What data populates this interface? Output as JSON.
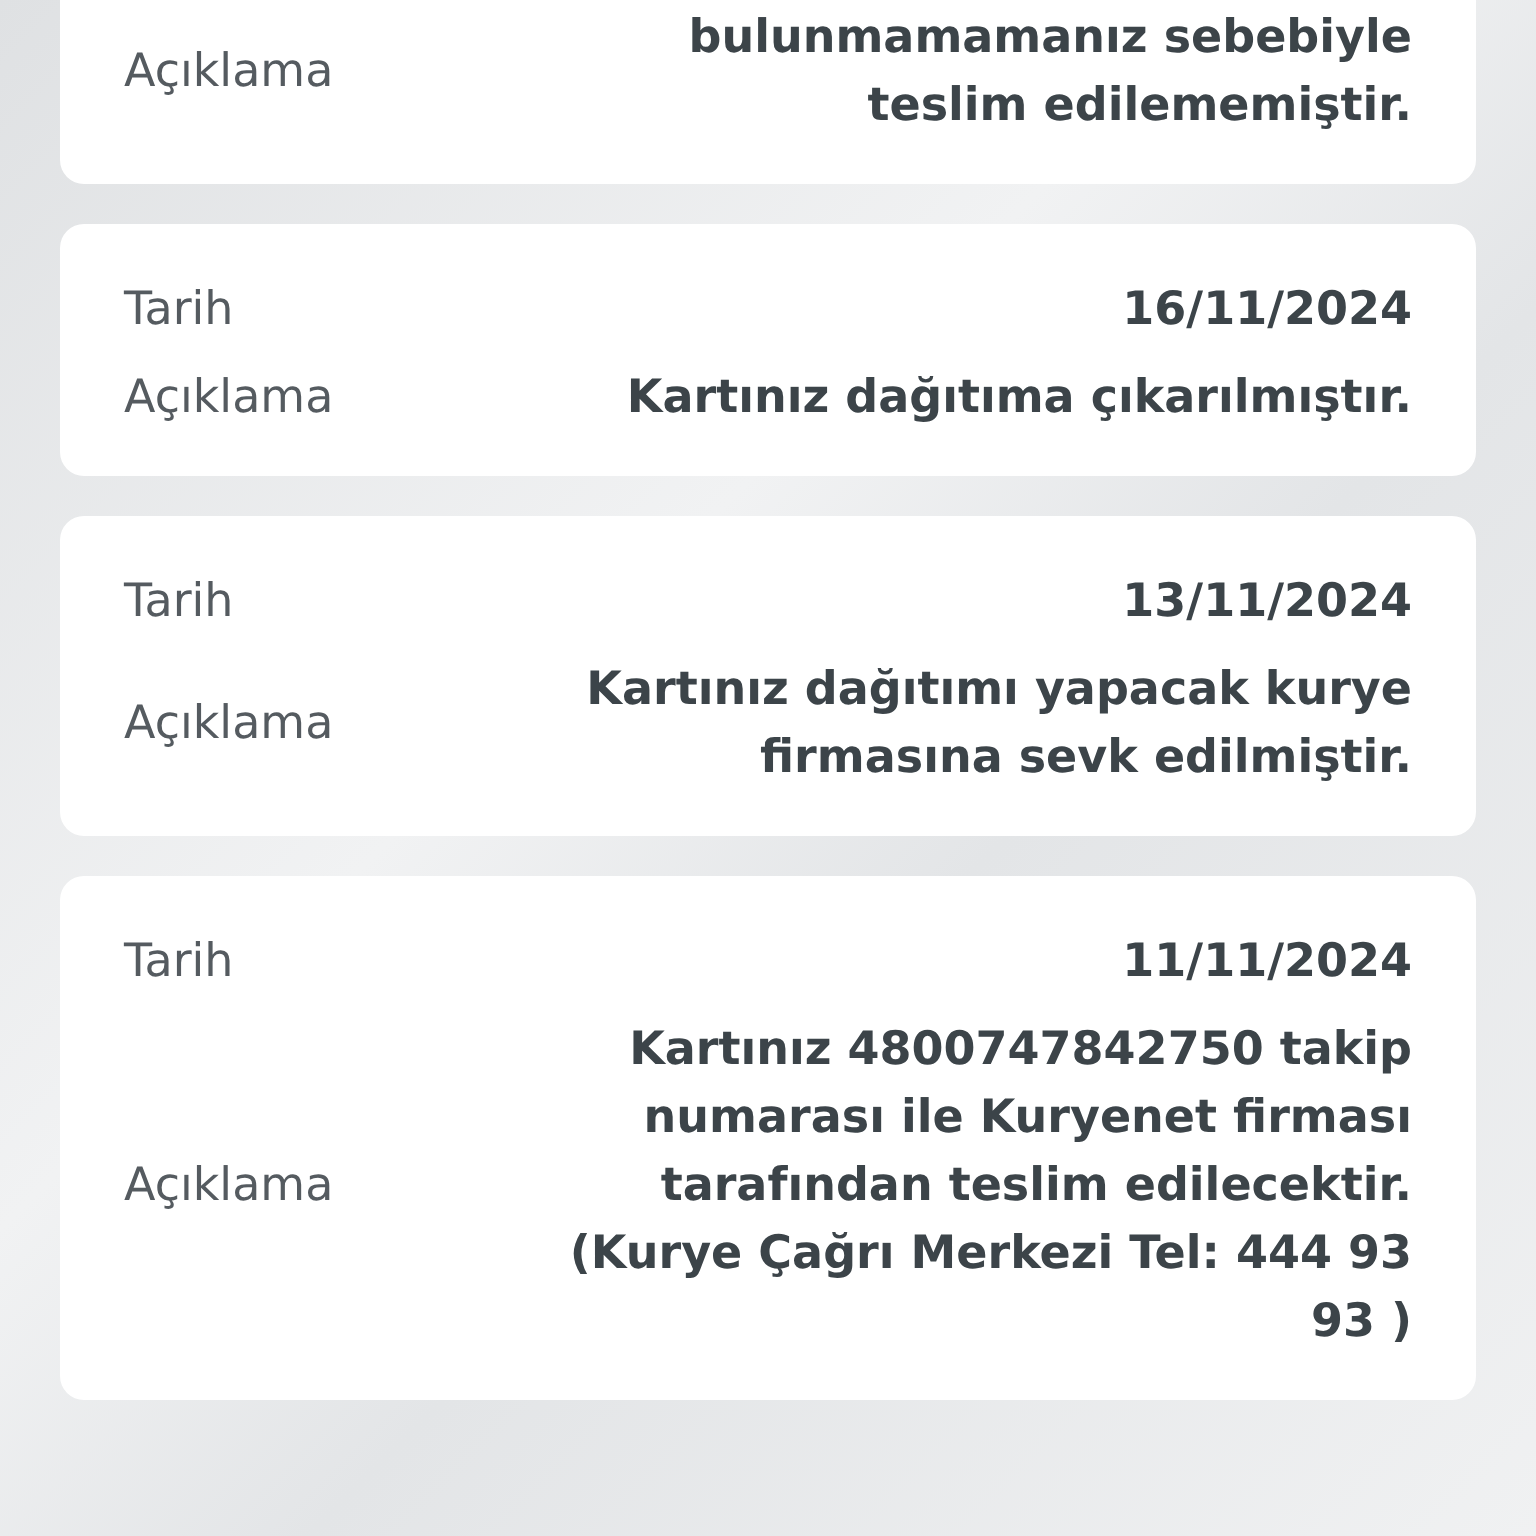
{
  "entries": [
    {
      "description_label": "Açıklama",
      "description": "bulunmamamanız sebebiyle teslim edilememiştir."
    },
    {
      "date_label": "Tarih",
      "date": "16/11/2024",
      "description_label": "Açıklama",
      "description": "Kartınız dağıtıma çıkarılmıştır."
    },
    {
      "date_label": "Tarih",
      "date": "13/11/2024",
      "description_label": "Açıklama",
      "description": "Kartınız dağıtımı yapacak kurye firmasına sevk edilmiştir."
    },
    {
      "date_label": "Tarih",
      "date": "11/11/2024",
      "description_label": "Açıklama",
      "description": "Kartınız 4800747842750 takip numarası ile Kuryenet firması tarafından teslim edilecektir. (Kurye Çağrı Merkezi Tel: 444 93 93 )"
    }
  ]
}
